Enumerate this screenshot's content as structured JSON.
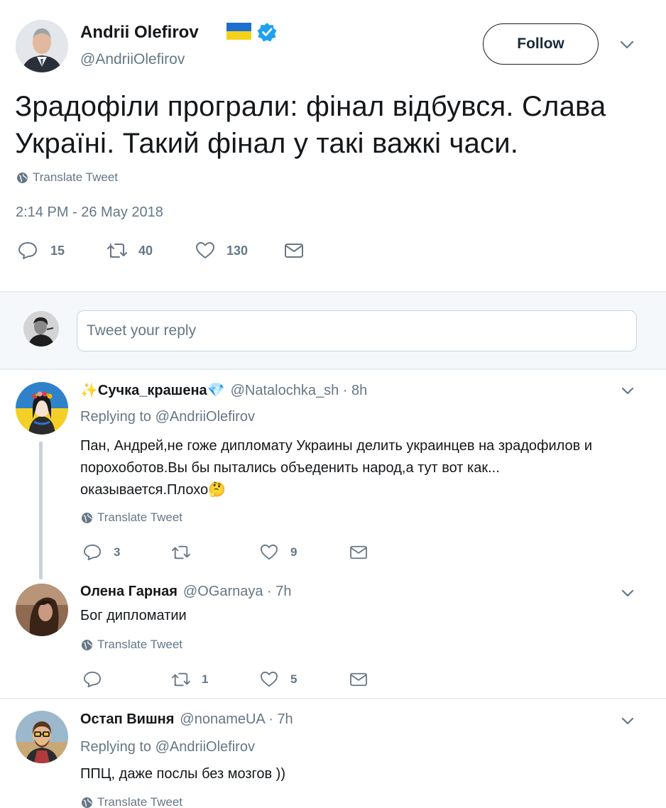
{
  "main_tweet": {
    "author_name": "Andrii Olefirov",
    "author_handle": "@AndriiOlefirov",
    "follow_label": "Follow",
    "text_line1": "Зрадофіли програли: фінал відбувся. Слава",
    "text_line2": "Україні. Такий фінал у такі важкі часи.",
    "translate_label": "Translate Tweet",
    "timestamp": "2:14 PM - 26 May 2018",
    "reply_count": "15",
    "retweet_count": "40",
    "like_count": "130"
  },
  "composer": {
    "placeholder": "Tweet your reply"
  },
  "replies": [
    {
      "name": "✨Сучка_крашена💎",
      "handle": "@Natalochka_sh · 8h",
      "replying_to": "Replying to @AndriiOlefirov",
      "text_line1": "Пан, Андрей,не гоже дипломату Украины делить украинцев на зрадофилов и",
      "text_line2": "порохоботов.Вы бы пытались объеденить народ,а тут вот как...",
      "text_line3": "оказывается.Плохо🤔",
      "translate_label": "Translate Tweet",
      "reply_count": "3",
      "retweet_count": "",
      "like_count": "9"
    },
    {
      "name": "Олена Гарная",
      "handle": "@OGarnaya · 7h",
      "text_line1": "Бог дипломатии",
      "translate_label": "Translate Tweet",
      "reply_count": "",
      "retweet_count": "1",
      "like_count": "5"
    },
    {
      "name": "Остап Вишня",
      "handle": "@nonameUA · 7h",
      "replying_to": "Replying to @AndriiOlefirov",
      "text_line1": "ППЦ, даже послы без мозгов ))",
      "translate_label": "Translate Tweet"
    }
  ],
  "colors": {
    "accent": "#1da1f2",
    "muted": "#657786",
    "text": "#14171a",
    "divider": "#e6ecf0"
  }
}
